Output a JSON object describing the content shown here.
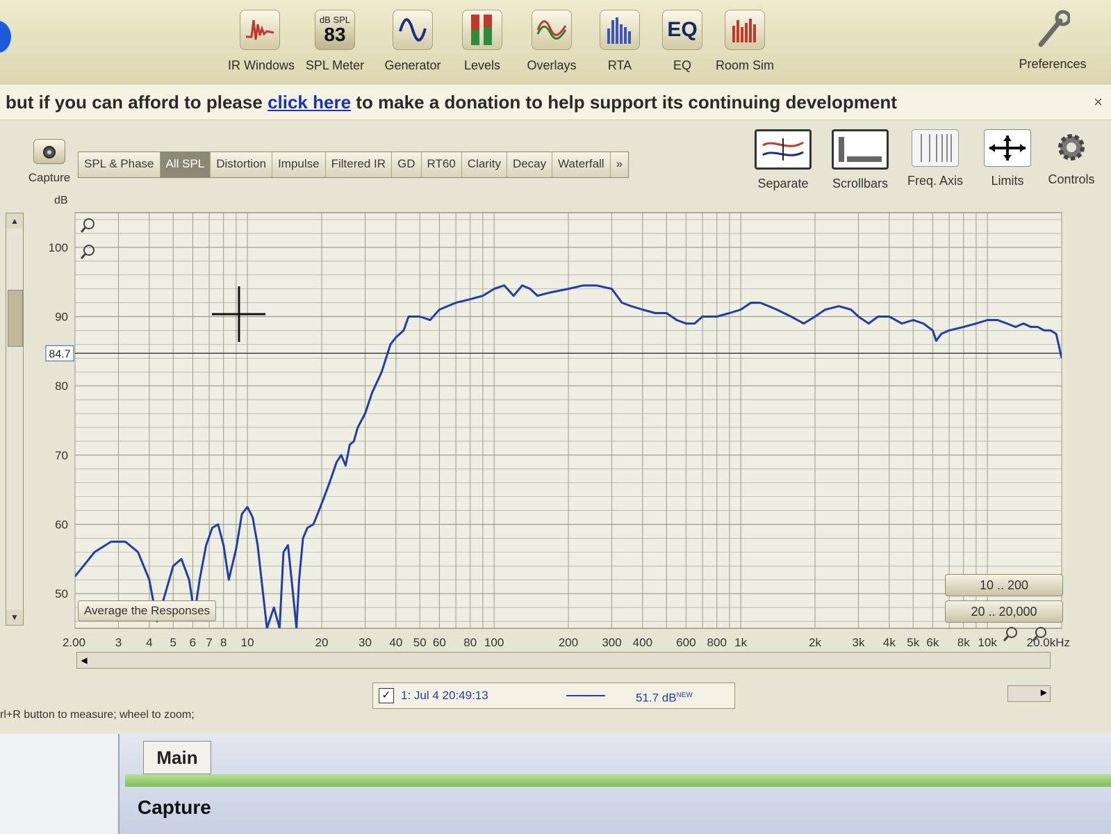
{
  "toolbar": {
    "items": [
      {
        "label": "IR Windows",
        "icon": "ir-windows-icon"
      },
      {
        "label": "SPL Meter",
        "icon": "spl-meter-icon",
        "icon_top": "dB SPL",
        "icon_value": "83"
      },
      {
        "label": "Generator",
        "icon": "generator-icon"
      },
      {
        "label": "Levels",
        "icon": "levels-icon"
      },
      {
        "label": "Overlays",
        "icon": "overlays-icon"
      },
      {
        "label": "RTA",
        "icon": "rta-icon"
      },
      {
        "label": "EQ",
        "icon": "eq-icon",
        "icon_text": "EQ"
      },
      {
        "label": "Room Sim",
        "icon": "room-sim-icon"
      }
    ],
    "preferences": "Preferences"
  },
  "banner": {
    "before": "but if you can afford to please",
    "link": "click here",
    "after": "to make a donation to help support its continuing development",
    "close": "×"
  },
  "capture_button": "Capture",
  "tabs": [
    "SPL & Phase",
    "All SPL",
    "Distortion",
    "Impulse",
    "Filtered IR",
    "GD",
    "RT60",
    "Clarity",
    "Decay",
    "Waterfall",
    "»"
  ],
  "active_tab": "All SPL",
  "right_buttons": [
    "Separate",
    "Scrollbars",
    "Freq. Axis",
    "Limits",
    "Controls"
  ],
  "average_button": "Average the Responses",
  "range_buttons": [
    "10 .. 200",
    "20 .. 20,000"
  ],
  "legend": {
    "checked": "✓",
    "name": "1: Jul 4 20:49:13",
    "value": "51.7 dB",
    "badge": "NEW"
  },
  "status": "rl+R button to measure; wheel to zoom;",
  "bottom": {
    "main_tab": "Main",
    "capture_title": "Capture"
  },
  "colors": {
    "trace": "#1f3fa6",
    "grid": "#9c9a8c",
    "plot_bg": "#efeee2"
  },
  "chart_data": {
    "type": "line",
    "ylabel": "dB",
    "xlabel": "",
    "x_scale": "log",
    "xlim": [
      2,
      20000
    ],
    "ylim": [
      45,
      105
    ],
    "ytick_labels": [
      "100",
      "90",
      "80",
      "70",
      "60",
      "50"
    ],
    "ytick_values": [
      100,
      90,
      80,
      70,
      60,
      50
    ],
    "cursor_level_label": "84.7",
    "cursor_level": 84.7,
    "xtick_labels": [
      "2.00",
      "3",
      "4",
      "5",
      "6",
      "7",
      "8",
      "10",
      "20",
      "30",
      "40",
      "50",
      "60",
      "80",
      "100",
      "200",
      "300",
      "400",
      "600",
      "800",
      "1k",
      "2k",
      "3k",
      "4k",
      "5k",
      "6k",
      "8k",
      "10k",
      "20.0kHz"
    ],
    "xtick_values": [
      2,
      3,
      4,
      5,
      6,
      7,
      8,
      10,
      20,
      30,
      40,
      50,
      60,
      80,
      100,
      200,
      300,
      400,
      600,
      800,
      1000,
      2000,
      3000,
      4000,
      5000,
      6000,
      8000,
      10000,
      20000
    ],
    "series": [
      {
        "name": "1: Jul 4 20:49:13",
        "x": [
          2,
          2.4,
          2.8,
          3.2,
          3.6,
          4.0,
          4.3,
          4.6,
          5.0,
          5.4,
          5.8,
          6.1,
          6.4,
          6.8,
          7.2,
          7.6,
          8.0,
          8.4,
          9.0,
          9.5,
          10.0,
          10.5,
          11.0,
          12.0,
          12.8,
          13.5,
          14.0,
          14.6,
          15.2,
          15.8,
          16.2,
          16.8,
          17.5,
          18.5,
          19.5,
          20.5,
          21.5,
          23,
          24,
          25,
          26,
          27,
          28,
          30,
          32,
          35,
          38,
          40,
          43,
          45,
          50,
          55,
          60,
          70,
          80,
          90,
          100,
          110,
          120,
          130,
          140,
          150,
          170,
          200,
          230,
          260,
          300,
          330,
          360,
          400,
          450,
          500,
          550,
          600,
          650,
          700,
          800,
          900,
          1000,
          1100,
          1200,
          1300,
          1400,
          1600,
          1800,
          2000,
          2200,
          2500,
          2800,
          3000,
          3300,
          3600,
          4000,
          4500,
          5000,
          5500,
          6000,
          6200,
          6500,
          7000,
          8000,
          9000,
          10000,
          11000,
          12000,
          13000,
          14000,
          15000,
          16000,
          17000,
          18000,
          19000,
          20000
        ],
        "y": [
          52.5,
          56.0,
          57.5,
          57.5,
          56.0,
          52.0,
          46.0,
          49.5,
          54.0,
          55.0,
          52.0,
          47.0,
          52.0,
          57.0,
          59.5,
          60.0,
          57.0,
          52.0,
          56.5,
          61.5,
          62.5,
          61.0,
          57.0,
          45.0,
          48.0,
          45.0,
          56.0,
          57.0,
          51.0,
          45.0,
          52.0,
          58.0,
          59.5,
          60.0,
          62.0,
          64.0,
          66.0,
          69.0,
          70.0,
          68.5,
          71.5,
          72.0,
          74.0,
          76.0,
          79.0,
          82.0,
          86.0,
          87.0,
          88.0,
          90.0,
          90.0,
          89.5,
          91.0,
          92.0,
          92.5,
          93.0,
          94.0,
          94.5,
          93.0,
          94.5,
          94.0,
          93.0,
          93.5,
          94.0,
          94.5,
          94.5,
          94.0,
          92.0,
          91.5,
          91.0,
          90.5,
          90.5,
          89.5,
          89.0,
          89.0,
          90.0,
          90.0,
          90.5,
          91.0,
          92.0,
          92.0,
          91.5,
          91.0,
          90.0,
          89.0,
          90.0,
          91.0,
          91.5,
          91.0,
          90.0,
          89.0,
          90.0,
          90.0,
          89.0,
          89.5,
          89.0,
          88.0,
          86.5,
          87.5,
          88.0,
          88.5,
          89.0,
          89.5,
          89.5,
          89.0,
          88.5,
          89.0,
          88.5,
          88.5,
          88.0,
          88.0,
          87.5,
          84.0
        ]
      }
    ]
  }
}
